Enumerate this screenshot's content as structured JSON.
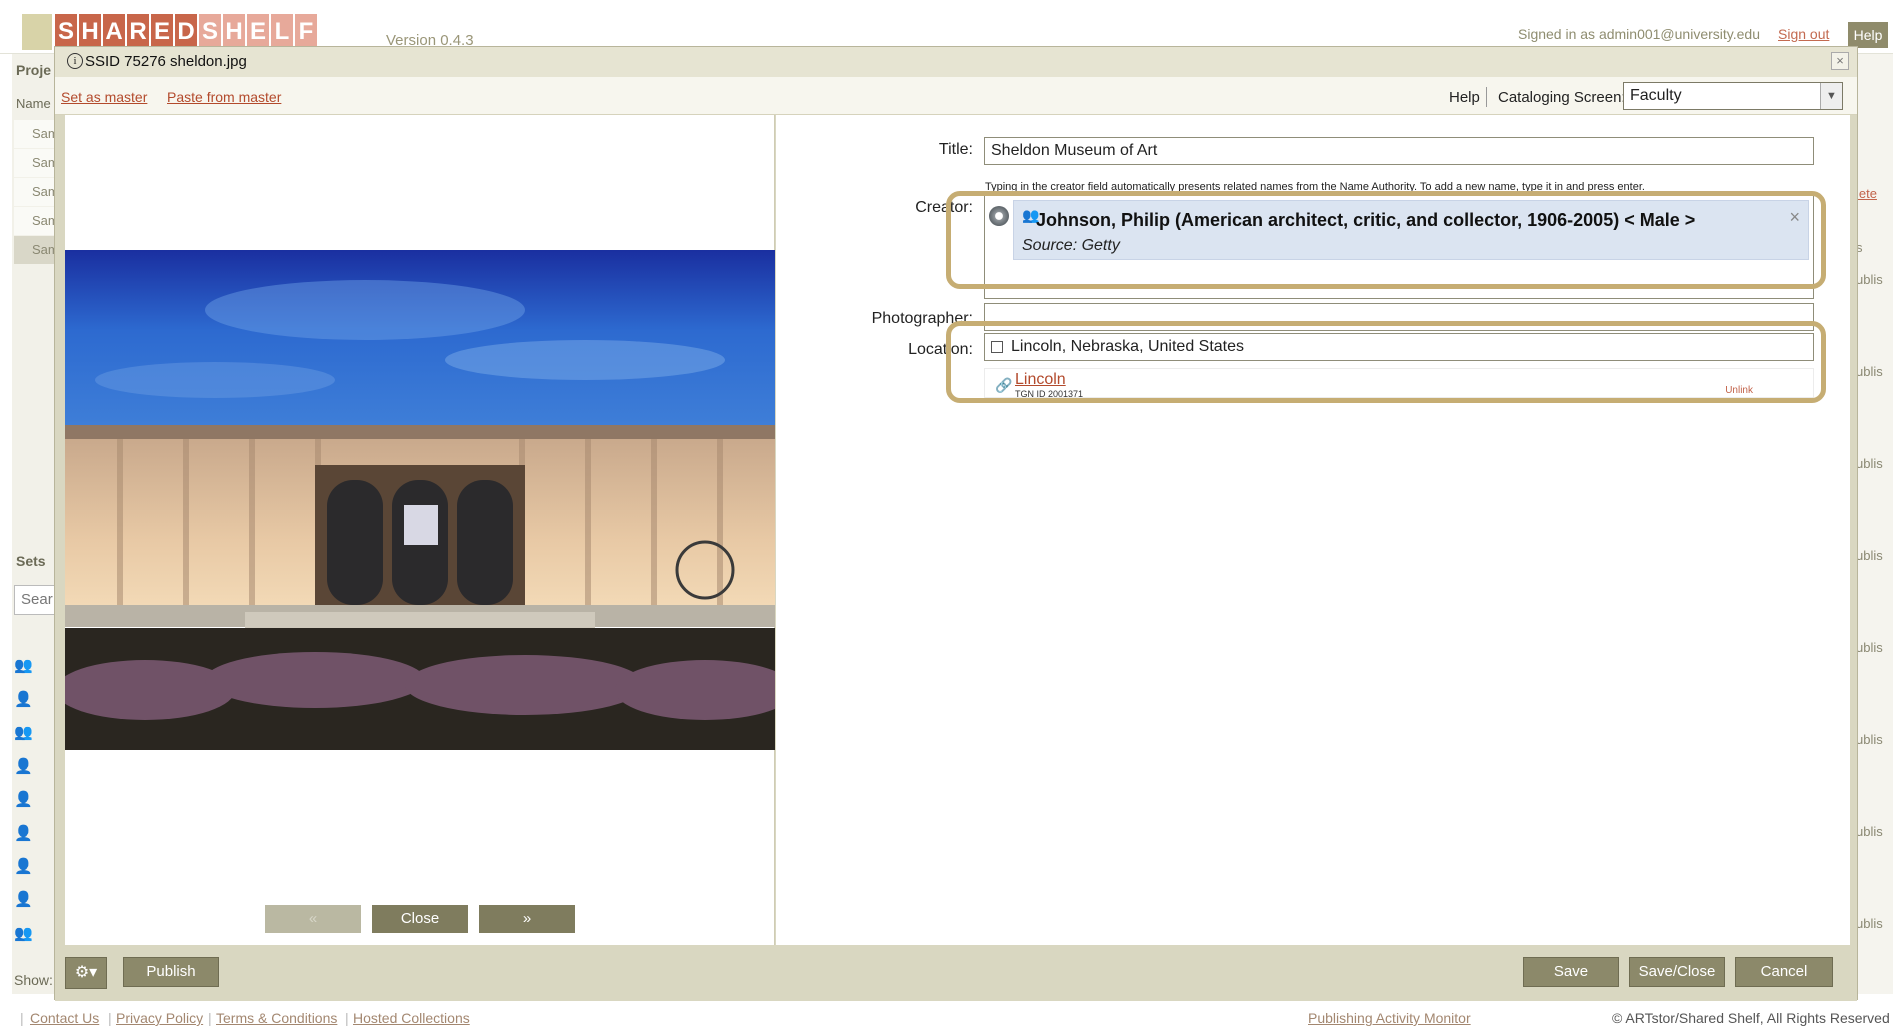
{
  "app": {
    "logo_letters": [
      "S",
      "H",
      "A",
      "R",
      "E",
      "D",
      "S",
      "H",
      "E",
      "L",
      "F"
    ],
    "version": "Version 0.4.3",
    "signed_in": "Signed in as admin001@university.edu",
    "sign_out": "Sign out",
    "help": "Help"
  },
  "background": {
    "projects_label": "Proje",
    "name_header": "Name",
    "project_rows": [
      "Sam",
      "Sam",
      "Sam",
      "Sam",
      "Sam"
    ],
    "sets_label": "Sets",
    "search_placeholder": "Sear",
    "show_label": "Show:",
    "right_col_header": "s",
    "right_col_delete": "lete",
    "right_col_values": [
      "ublis",
      "ublis",
      "ublis",
      "ublis",
      "ublis",
      "ublis",
      "ublis",
      "ublis"
    ]
  },
  "modal": {
    "info_icon": "i",
    "ssid": "SSID 75276  sheldon.jpg",
    "close_glyph": "×",
    "toolbar": {
      "set_as_master": "Set as master",
      "paste_from_master": "Paste from master",
      "help": "Help",
      "cataloging_label": "Cataloging Screen:",
      "cataloging_value": "Faculty"
    },
    "nav": {
      "prev": "«",
      "close": "Close",
      "next": "»"
    },
    "form": {
      "title_label": "Title:",
      "title_value": "Sheldon Museum of Art",
      "creator_label": "Creator:",
      "creator_hint": "Typing in the creator field automatically presents related names from the Name Authority. To add a new name, type it in and press enter.",
      "creator_name": "Johnson, Philip (American architect, critic, and collector, 1906-2005) < Male >",
      "creator_source": "Source: Getty",
      "creator_remove": "×",
      "photographer_label": "Photographer:",
      "photographer_value": "",
      "location_label": "Location:",
      "location_value": "Lincoln, Nebraska, United States",
      "location_result_name": "Lincoln",
      "location_result_tgn": "TGN ID 2001371",
      "location_unlink": "Unlink"
    },
    "bottom": {
      "publish": "Publish",
      "save": "Save",
      "save_close": "Save/Close",
      "cancel": "Cancel"
    }
  },
  "footer": {
    "links": [
      "Contact Us",
      "Privacy Policy",
      "Terms & Conditions",
      "Hosted Collections"
    ],
    "publishing_monitor": "Publishing Activity Monitor",
    "copyright": "© ARTstor/Shared Shelf, All Rights Reserved"
  },
  "colors": {
    "accent_link": "#b34a2c",
    "button": "#8c896a",
    "highlight_border": "#c6ad73",
    "modal_bg": "#d9d7c1"
  }
}
